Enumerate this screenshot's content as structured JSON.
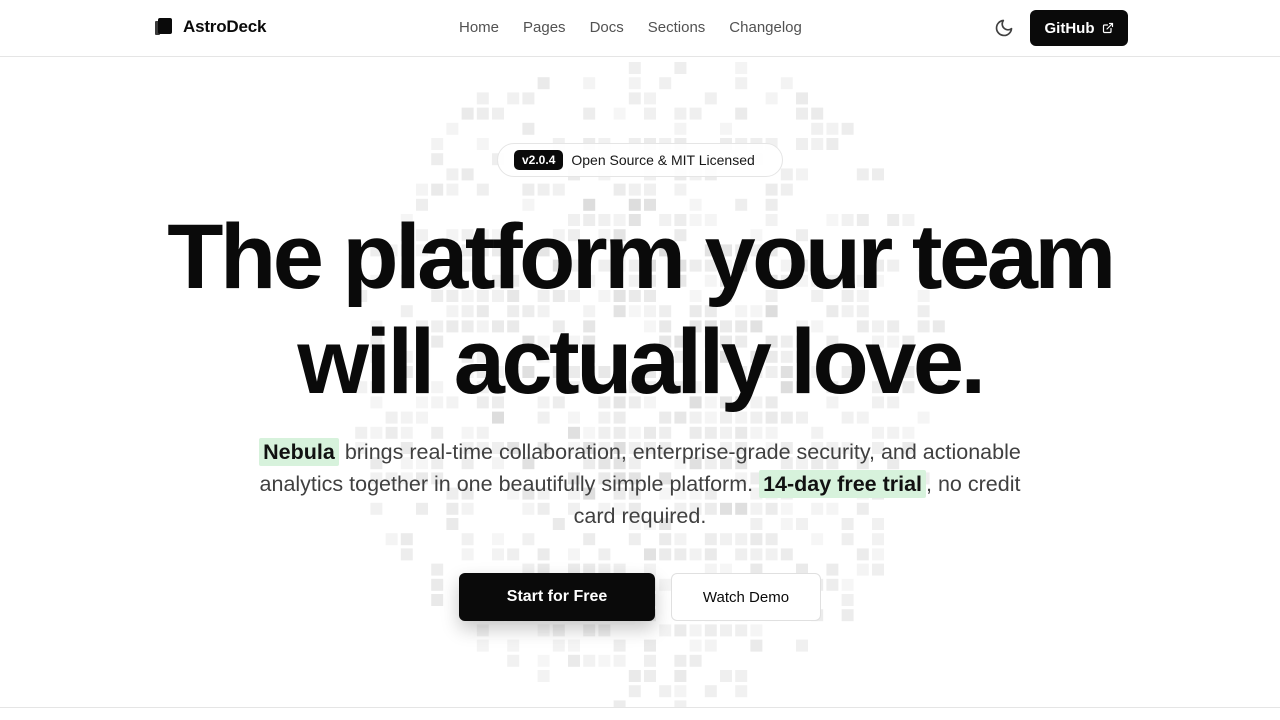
{
  "brand": {
    "name": "AstroDeck"
  },
  "nav": {
    "links": [
      "Home",
      "Pages",
      "Docs",
      "Sections",
      "Changelog"
    ],
    "github_label": "GitHub"
  },
  "hero": {
    "badge_version": "v2.0.4",
    "badge_text": "Open Source & MIT Licensed",
    "headline_line1": "The platform your team",
    "headline_line2": "will actually love.",
    "subtitle_highlight1": "Nebula",
    "subtitle_text1": " brings real-time collaboration, enterprise-grade security, and actionable analytics together in one beautifully simple platform. ",
    "subtitle_highlight2": "14-day free trial",
    "subtitle_text2": ", no credit card required.",
    "primary_cta": "Start for Free",
    "secondary_cta": "Watch Demo"
  },
  "colors": {
    "primary": "#0a0a0a",
    "highlight": "#d7f2dc",
    "border": "#e5e5e5"
  }
}
